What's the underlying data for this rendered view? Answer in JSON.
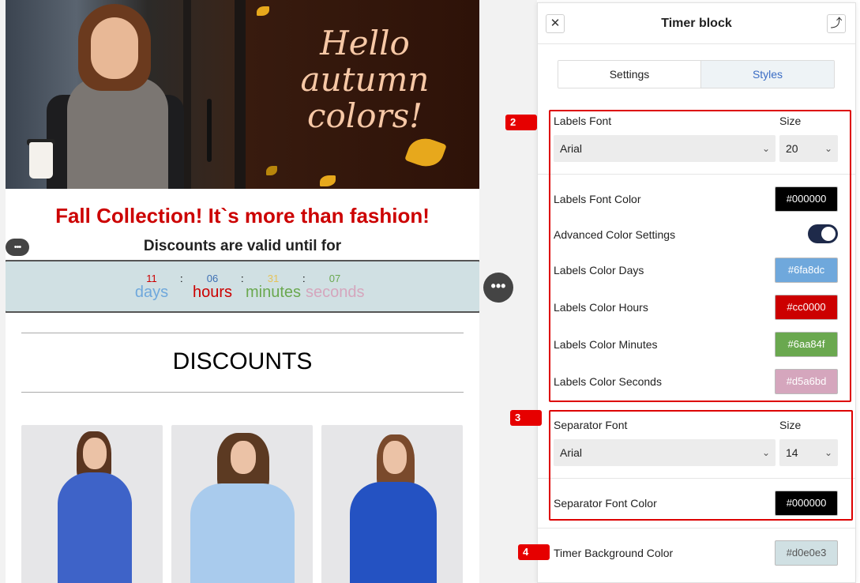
{
  "hero": {
    "text_line1": "Hello",
    "text_line2": "autumn",
    "text_line3": "colors!"
  },
  "email": {
    "headline": "Fall Collection! It`s more than fashion!",
    "subheadline": "Discounts are valid until for",
    "section_title": "DISCOUNTS"
  },
  "timer": {
    "background": "#d0e0e3",
    "days": {
      "value": "11",
      "label": "days",
      "num_color": "#cc0000",
      "label_color": "#6fa8dc"
    },
    "hours": {
      "value": "06",
      "label": "hours",
      "num_color": "#3d6fb4",
      "label_color": "#cc0000"
    },
    "minutes": {
      "value": "31",
      "label": "minutes",
      "num_color": "#e5c35a",
      "label_color": "#6aa84f"
    },
    "seconds": {
      "value": "07",
      "label": "seconds",
      "num_color": "#6aa84f",
      "label_color": "#d5a6bd"
    },
    "separator": ":"
  },
  "panel": {
    "title": "Timer block",
    "close_icon": "close-icon",
    "move_icon": "move-icon",
    "tabs": [
      {
        "label": "Settings",
        "active": false
      },
      {
        "label": "Styles",
        "active": true
      }
    ],
    "labels_font": {
      "label": "Labels Font",
      "value": "Arial",
      "size_label": "Size",
      "size_value": "20"
    },
    "labels_font_color": {
      "label": "Labels Font Color",
      "value": "#000000"
    },
    "advanced_color": {
      "label": "Advanced Color Settings",
      "enabled": true
    },
    "labels_color_days": {
      "label": "Labels Color Days",
      "value": "#6fa8dc"
    },
    "labels_color_hours": {
      "label": "Labels Color Hours",
      "value": "#cc0000"
    },
    "labels_color_minutes": {
      "label": "Labels Color Minutes",
      "value": "#6aa84f"
    },
    "labels_color_seconds": {
      "label": "Labels Color Seconds",
      "value": "#d5a6bd"
    },
    "separator_font": {
      "label": "Separator Font",
      "value": "Arial",
      "size_label": "Size",
      "size_value": "14"
    },
    "separator_font_color": {
      "label": "Separator Font Color",
      "value": "#000000"
    },
    "timer_bg_color": {
      "label": "Timer Background Color",
      "value": "#d0e0e3"
    }
  },
  "annotations": {
    "badge2": "2",
    "badge3": "3",
    "badge4": "4"
  },
  "colors": {
    "accent": "#cc0000",
    "highlight_box": "#dd0000",
    "toggle_on": "#1e2a4a",
    "tab_active_text": "#3a6cc4"
  }
}
